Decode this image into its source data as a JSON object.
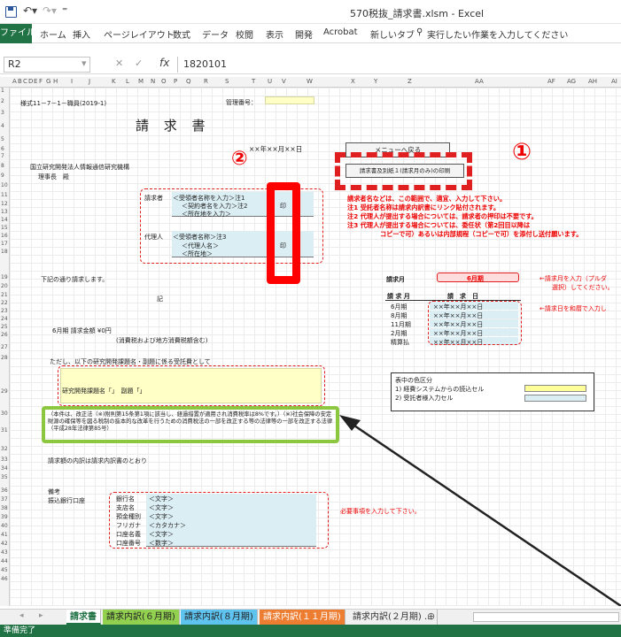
{
  "window": {
    "title": "570税抜_請求書.xlsm - Excel"
  },
  "ribbon": {
    "tabs": [
      "ファイル",
      "ホーム",
      "挿入",
      "ページレイアウト",
      "数式",
      "データ",
      "校閲",
      "表示",
      "開発",
      "Acrobat",
      "新しいタブ"
    ],
    "search": "実行したい作業を入力してください"
  },
  "formula": {
    "cell": "R2",
    "value": "1820101"
  },
  "columns": [
    "A",
    "B",
    "C",
    "D",
    "E",
    "F",
    "G",
    "H",
    "I",
    "J",
    "K",
    "L",
    "M",
    "N",
    "O",
    "P",
    "Q",
    "R",
    "S",
    "T",
    "U",
    "V",
    "W",
    "X",
    "Y",
    "Z",
    "AA",
    "AF",
    "AG",
    "AH",
    "AI"
  ],
  "rows": [
    "1",
    "2",
    "3",
    "4",
    "5",
    "6",
    "7",
    "8",
    "9",
    "10",
    "11",
    "12",
    "13",
    "14",
    "15",
    "16",
    "17",
    "18",
    "19",
    "20",
    "21",
    "22",
    "23",
    "24",
    "25",
    "26",
    "27",
    "28",
    "29",
    "30",
    "31",
    "32",
    "33",
    "34",
    "35",
    "36",
    "37",
    "38",
    "39",
    "40",
    "41",
    "42",
    "43",
    "44",
    "45",
    "46"
  ],
  "sheet": {
    "form_id": "様式11－7－1－職員(2019-1)",
    "mgmt_label": "管理番号：",
    "title": "請 求 書",
    "date": "××年××月××日",
    "org": "国立研究開発法人情報通信研究機構",
    "president": "理事長　殿",
    "claimant_label": "請求者",
    "claimant": [
      "＜受領者名称を入力＞注1",
      "＜契約者名を入力＞注2",
      "＜所在地を入力＞"
    ],
    "agent_label": "代理人",
    "agent": [
      "＜受領者名称＞注3",
      "＜代理人名＞",
      "＜所在地＞"
    ],
    "seal": "印",
    "menu_btn": "メニューへ戻る",
    "print_btn": "請求書及別紙１(請求月のみ)の印刷",
    "notes": [
      "請求者名などは、この範囲で、適宜、入力して下さい。",
      "注1 受託者名称は請求内訳書にリンク貼付されます。",
      "注2 代理人が提出する場合については、請求者の押印は不要です。",
      "注3 代理人が提出する場合については、委任状（第2回目以降は",
      "コピーで可）あるいは内部規程（コピーで可）を添付し送付願います。"
    ],
    "claim_text": "下記の通り請求します。",
    "ki": "記",
    "amount": "6月期  請求金額  ¥0円",
    "amount_note": "(消費税および地方消費税額含む)",
    "proviso": "ただし、以下の研究開発課題名・副題に係る受託費として",
    "subject": "研究開発課題名「」　副題「」",
    "tax_note": "（本件は、改正法（※)附則第15条第1項に該当し、経過措置が適用され消費税率は8%です。）（※)社会保障の安定財源の確保等を図る税制の抜本的な改革を行うための消費税法の一部を改正する等の法律等の一部を改正する法律（平成28年法律第85号）",
    "breakdown": "請求額の内訳は請求内訳書のとおり",
    "month_label": "請求月",
    "month_value": "6月期",
    "month_hint": "←請求月を入力（プルダ",
    "month_hint2": "選択）してください。",
    "table_head": [
      "請 求 月",
      "請　求　日"
    ],
    "table_rows": [
      [
        "6月期",
        "××年××月××日"
      ],
      [
        "8月期",
        "××年××月××日"
      ],
      [
        "11月期",
        "××年××月××日"
      ],
      [
        "2月期",
        "××年××月××日"
      ],
      [
        "精算払",
        "××年××月××日"
      ]
    ],
    "table_hint": "←請求日を和暦で入力し",
    "legend_title": "表中の色区分",
    "legend": [
      "1) 経費システムからの読込セル",
      "2) 受託者様入力セル"
    ],
    "remarks": "備考",
    "bank_label": "振込銀行口座",
    "bank": [
      [
        "銀行名",
        "＜文字＞"
      ],
      [
        "支店名",
        "＜文字＞"
      ],
      [
        "預金種別",
        "＜文字＞"
      ],
      [
        "フリガナ",
        "＜カタカナ＞"
      ],
      [
        "口座名義",
        "＜文字＞"
      ],
      [
        "口座番号",
        "＜数字＞"
      ]
    ],
    "bank_hint": "必要事項を入力して下さい。",
    "num1": "①",
    "num2": "②"
  },
  "sheet_tabs": [
    "請求書",
    "請求内訳(６月期)",
    "請求内訳(８月期)",
    "請求内訳(１１月期)",
    "請求内訳(２月期)  ..."
  ],
  "status": "準備完了",
  "colors": {
    "excel_green": "#217346",
    "red": "#e00000",
    "green": "#8dc63f",
    "yellow": "#ffffc6",
    "blue": "#dbeef4"
  }
}
